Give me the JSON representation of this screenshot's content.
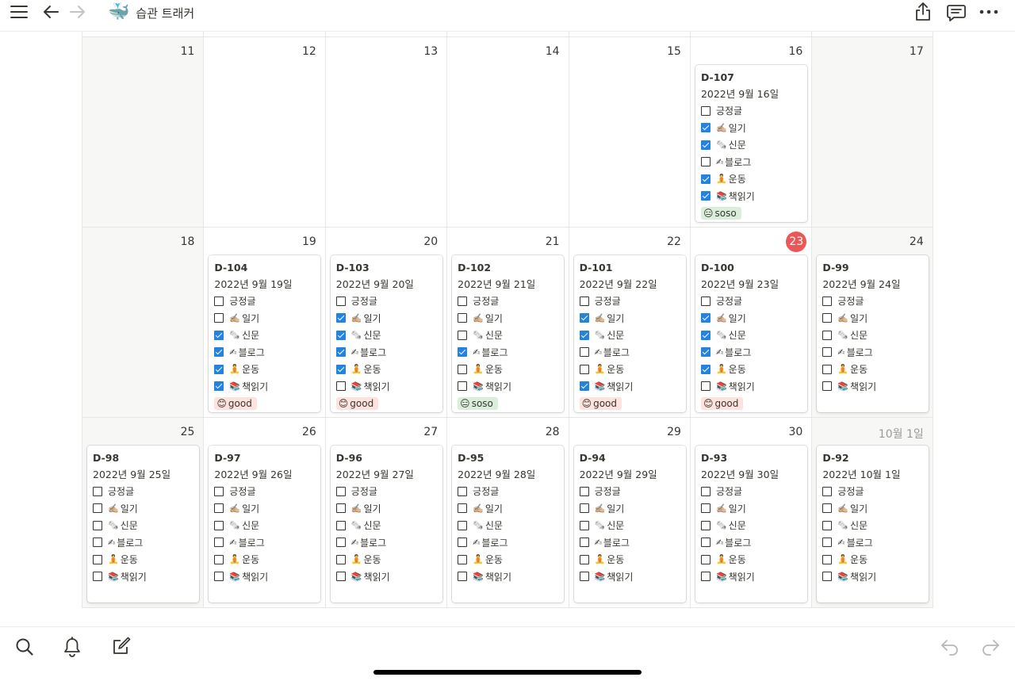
{
  "header": {
    "title": "습관 트래커",
    "page_icon": "whale-emoji",
    "icons": [
      "menu-icon",
      "back-arrow-icon",
      "forward-arrow-icon",
      "share-icon",
      "comments-icon",
      "more-icon"
    ]
  },
  "emoji": {
    "일기": "✍🏼",
    "신문": "🗞️",
    "블로그": "✍",
    "운동": "🧘",
    "책읽기": "📚",
    "good": "😊",
    "soso": "😑"
  },
  "weeks": [
    {
      "days": [
        {
          "date": "11",
          "weekend": true
        },
        {
          "date": "12"
        },
        {
          "date": "13"
        },
        {
          "date": "14"
        },
        {
          "date": "15"
        },
        {
          "date": "16",
          "card": {
            "title": "D-107",
            "date": "2022년 9월 16일",
            "items": [
              {
                "label": "긍정글",
                "checked": false
              },
              {
                "label": "일기",
                "checked": true
              },
              {
                "label": "신문",
                "checked": true
              },
              {
                "label": "블로그",
                "checked": false
              },
              {
                "label": "운동",
                "checked": true
              },
              {
                "label": "책읽기",
                "checked": true
              }
            ],
            "mood": "soso"
          }
        },
        {
          "date": "17",
          "weekend": true
        }
      ]
    },
    {
      "days": [
        {
          "date": "18",
          "weekend": true
        },
        {
          "date": "19",
          "card": {
            "title": "D-104",
            "date": "2022년 9월 19일",
            "items": [
              {
                "label": "긍정글",
                "checked": false
              },
              {
                "label": "일기",
                "checked": false
              },
              {
                "label": "신문",
                "checked": true
              },
              {
                "label": "블로그",
                "checked": true
              },
              {
                "label": "운동",
                "checked": true
              },
              {
                "label": "책읽기",
                "checked": true
              }
            ],
            "mood": "good"
          }
        },
        {
          "date": "20",
          "card": {
            "title": "D-103",
            "date": "2022년 9월 20일",
            "items": [
              {
                "label": "긍정글",
                "checked": false
              },
              {
                "label": "일기",
                "checked": true
              },
              {
                "label": "신문",
                "checked": true
              },
              {
                "label": "블로그",
                "checked": true
              },
              {
                "label": "운동",
                "checked": true
              },
              {
                "label": "책읽기",
                "checked": false
              }
            ],
            "mood": "good"
          }
        },
        {
          "date": "21",
          "card": {
            "title": "D-102",
            "date": "2022년 9월 21일",
            "items": [
              {
                "label": "긍정글",
                "checked": false
              },
              {
                "label": "일기",
                "checked": false
              },
              {
                "label": "신문",
                "checked": false
              },
              {
                "label": "블로그",
                "checked": true
              },
              {
                "label": "운동",
                "checked": false
              },
              {
                "label": "책읽기",
                "checked": false
              }
            ],
            "mood": "soso"
          }
        },
        {
          "date": "22",
          "card": {
            "title": "D-101",
            "date": "2022년 9월 22일",
            "items": [
              {
                "label": "긍정글",
                "checked": false
              },
              {
                "label": "일기",
                "checked": true
              },
              {
                "label": "신문",
                "checked": true
              },
              {
                "label": "블로그",
                "checked": false
              },
              {
                "label": "운동",
                "checked": false
              },
              {
                "label": "책읽기",
                "checked": true
              }
            ],
            "mood": "good"
          }
        },
        {
          "date": "23",
          "today": true,
          "card": {
            "title": "D-100",
            "date": "2022년 9월 23일",
            "items": [
              {
                "label": "긍정글",
                "checked": false
              },
              {
                "label": "일기",
                "checked": true
              },
              {
                "label": "신문",
                "checked": true
              },
              {
                "label": "블로그",
                "checked": true
              },
              {
                "label": "운동",
                "checked": true
              },
              {
                "label": "책읽기",
                "checked": false
              }
            ],
            "mood": "good"
          }
        },
        {
          "date": "24",
          "weekend": true,
          "card": {
            "title": "D-99",
            "date": "2022년 9월 24일",
            "items": [
              {
                "label": "긍정글",
                "checked": false
              },
              {
                "label": "일기",
                "checked": false
              },
              {
                "label": "신문",
                "checked": false
              },
              {
                "label": "블로그",
                "checked": false
              },
              {
                "label": "운동",
                "checked": false
              },
              {
                "label": "책읽기",
                "checked": false
              }
            ]
          }
        }
      ]
    },
    {
      "days": [
        {
          "date": "25",
          "weekend": true,
          "card": {
            "title": "D-98",
            "date": "2022년 9월 25일",
            "items": [
              {
                "label": "긍정글",
                "checked": false
              },
              {
                "label": "일기",
                "checked": false
              },
              {
                "label": "신문",
                "checked": false
              },
              {
                "label": "블로그",
                "checked": false
              },
              {
                "label": "운동",
                "checked": false
              },
              {
                "label": "책읽기",
                "checked": false
              }
            ]
          }
        },
        {
          "date": "26",
          "card": {
            "title": "D-97",
            "date": "2022년 9월 26일",
            "items": [
              {
                "label": "긍정글",
                "checked": false
              },
              {
                "label": "일기",
                "checked": false
              },
              {
                "label": "신문",
                "checked": false
              },
              {
                "label": "블로그",
                "checked": false
              },
              {
                "label": "운동",
                "checked": false
              },
              {
                "label": "책읽기",
                "checked": false
              }
            ]
          }
        },
        {
          "date": "27",
          "card": {
            "title": "D-96",
            "date": "2022년 9월 27일",
            "items": [
              {
                "label": "긍정글",
                "checked": false
              },
              {
                "label": "일기",
                "checked": false
              },
              {
                "label": "신문",
                "checked": false
              },
              {
                "label": "블로그",
                "checked": false
              },
              {
                "label": "운동",
                "checked": false
              },
              {
                "label": "책읽기",
                "checked": false
              }
            ]
          }
        },
        {
          "date": "28",
          "card": {
            "title": "D-95",
            "date": "2022년 9월 28일",
            "items": [
              {
                "label": "긍정글",
                "checked": false
              },
              {
                "label": "일기",
                "checked": false
              },
              {
                "label": "신문",
                "checked": false
              },
              {
                "label": "블로그",
                "checked": false
              },
              {
                "label": "운동",
                "checked": false
              },
              {
                "label": "책읽기",
                "checked": false
              }
            ]
          }
        },
        {
          "date": "29",
          "card": {
            "title": "D-94",
            "date": "2022년 9월 29일",
            "items": [
              {
                "label": "긍정글",
                "checked": false
              },
              {
                "label": "일기",
                "checked": false
              },
              {
                "label": "신문",
                "checked": false
              },
              {
                "label": "블로그",
                "checked": false
              },
              {
                "label": "운동",
                "checked": false
              },
              {
                "label": "책읽기",
                "checked": false
              }
            ]
          }
        },
        {
          "date": "30",
          "card": {
            "title": "D-93",
            "date": "2022년 9월 30일",
            "items": [
              {
                "label": "긍정글",
                "checked": false
              },
              {
                "label": "일기",
                "checked": false
              },
              {
                "label": "신문",
                "checked": false
              },
              {
                "label": "블로그",
                "checked": false
              },
              {
                "label": "운동",
                "checked": false
              },
              {
                "label": "책읽기",
                "checked": false
              }
            ]
          }
        },
        {
          "date": "10월 1일",
          "weekend": true,
          "muted": true,
          "card": {
            "title": "D-92",
            "date": "2022년 10월 1일",
            "items": [
              {
                "label": "긍정글",
                "checked": false
              },
              {
                "label": "일기",
                "checked": false
              },
              {
                "label": "신문",
                "checked": false
              },
              {
                "label": "블로그",
                "checked": false
              },
              {
                "label": "운동",
                "checked": false
              },
              {
                "label": "책읽기",
                "checked": false
              }
            ]
          }
        }
      ]
    }
  ],
  "colors": {
    "checkbox_checked": "#2383e2",
    "today_badge": "#eb5757",
    "mood_good_bg": "#fde2dd",
    "mood_soso_bg": "#dbeddb"
  },
  "bottom_toolbar": {
    "icons": [
      "search-icon",
      "bell-icon",
      "compose-icon",
      "undo-icon",
      "redo-icon"
    ]
  }
}
